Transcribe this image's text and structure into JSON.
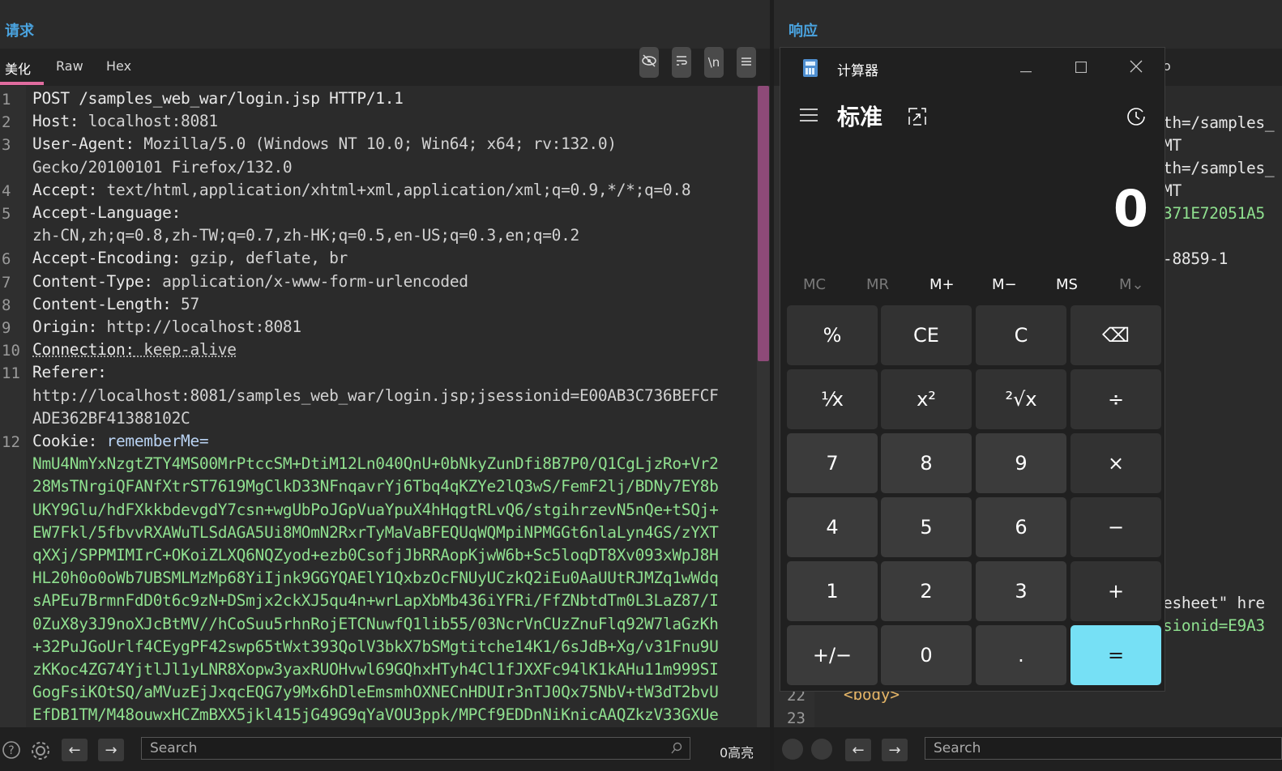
{
  "request": {
    "title": "请求",
    "tabs": [
      "美化",
      "Raw",
      "Hex"
    ],
    "toolbar": {
      "wrap": "\\n"
    },
    "lines": [
      {
        "n": "1",
        "name": "POST /samples_web_war/login.jsp HTTP/1.1",
        "value": ""
      },
      {
        "n": "2",
        "name": "Host:",
        "value": " localhost:8081"
      },
      {
        "n": "3",
        "name": "User-Agent:",
        "value": " Mozilla/5.0 (Windows NT 10.0; Win64; x64; rv:132.0)"
      },
      {
        "n": "",
        "name": "",
        "value": "Gecko/20100101 Firefox/132.0"
      },
      {
        "n": "4",
        "name": "Accept:",
        "value": " text/html,application/xhtml+xml,application/xml;q=0.9,*/*;q=0.8"
      },
      {
        "n": "5",
        "name": "Accept-Language:",
        "value": ""
      },
      {
        "n": "",
        "name": "",
        "value": "zh-CN,zh;q=0.8,zh-TW;q=0.7,zh-HK;q=0.5,en-US;q=0.3,en;q=0.2"
      },
      {
        "n": "6",
        "name": "Accept-Encoding:",
        "value": " gzip, deflate, br"
      },
      {
        "n": "7",
        "name": "Content-Type:",
        "value": " application/x-www-form-urlencoded"
      },
      {
        "n": "8",
        "name": "Content-Length:",
        "value": " 57"
      },
      {
        "n": "9",
        "name": "Origin:",
        "value": " http://localhost:8081"
      },
      {
        "n": "10",
        "name": "Connection:",
        "value": " keep-alive"
      },
      {
        "n": "11",
        "name": "Referer:",
        "value": ""
      },
      {
        "n": "",
        "name": "",
        "value": "http://localhost:8081/samples_web_war/login.jsp;jsessionid=E00AB3C736BEFCF"
      },
      {
        "n": "",
        "name": "",
        "value": "ADE362BF41388102C"
      },
      {
        "n": "12",
        "name": "Cookie:",
        "value": " rememberMe="
      }
    ],
    "cookie_lines": [
      "NmU4NmYxNzgtZTY4MS00MrPtccSM+DtiM12Ln040QnU+0bNkyZunDfi8B7P0/Q1CgLjzRo+Vr2",
      "28MsTNrgiQFANfXtrST7619MgClkD33NFnqavrYj6Tbq4qKZYe2lQ3wS/FemF2lj/BDNy7EY8b",
      "UKY9Glu/hdFXkkbdevgdY7csn+wgUbPoJGpVuaYpuX4hHqgtRLvQ6/stgihrzevN5nQe+tSQj+",
      "EW7Fkl/5fbvvRXAWuTLSdAGA5Ui8MOmN2RxrTyMaVaBFEQUqWQMpiNPMGGt6nlaLyn4GS/zYXT",
      "qXXj/SPPMIMIrC+OKoiZLXQ6NQZyod+ezb0CsofjJbRRAopKjwW6b+Sc5loqDT8Xv093xWpJ8H",
      "HL20h0o0oWb7UBSMLMzMp68YiIjnk9GGYQAElY1QxbzOcFNUyUCzkQ2iEu0AaUUtRJMZq1wWdq",
      "sAPEu7BrmnFdD0t6c9zN+DSmjx2ckXJ5qu4n+wrLapXbMb436iYFRi/FfZNbtdTm0L3LaZ87/I",
      "0ZuX8y3J9noXJcBtMV//hCoSuu5rhnRojETCNuwfQ1lib55/03NcrVnCUzZnuFlq92W7laGzKh",
      "+32PuJGoUrlf4CEygPF42swp65tWxt393QolV3bkX7bSMgtitche14K1/6sJdB+Xg/v31Fnu9U",
      "zKKoc4ZG74YjtlJl1yLNR8Xopw3yaxRUOHvwl69GQhxHTyh4Cl1fJXXFc94lK1kAHu11m999SI",
      "GogFsiKOtSQ/aMVuzEjJxqcEQG7y9Mx6hDleEmsmhOXNECnHDUIr3nTJ0Qx75NbV+tW3dT2bvU",
      "EfDB1TM/M48ouwxHCZmBXX5jkl415jG49G9qYaVOU3ppk/MPCf9EDDnNiKnicAAQZkzV33GXUe"
    ],
    "search_placeholder": "Search",
    "highlight_count": "0高亮"
  },
  "response": {
    "title": "响应",
    "tab_fragment": "o",
    "visible_fragments": [
      "th=/samples_",
      "MT",
      "th=/samples_",
      "MT",
      "371E72051A5",
      "-8859-1",
      "esheet\" hre",
      "sionid=E9A3"
    ],
    "line_numbers": [
      "22",
      "23"
    ],
    "body_tag": "<body>",
    "search_placeholder": "Search"
  },
  "calculator": {
    "window_title": "计算器",
    "mode": "标准",
    "display": "0",
    "memory": [
      "MC",
      "MR",
      "M+",
      "M−",
      "MS",
      "M⌄"
    ],
    "keys": [
      [
        "%",
        "CE",
        "C",
        "⌫"
      ],
      [
        "⅟x",
        "x²",
        "²√x",
        "÷"
      ],
      [
        "7",
        "8",
        "9",
        "×"
      ],
      [
        "4",
        "5",
        "6",
        "−"
      ],
      [
        "1",
        "2",
        "3",
        "+"
      ],
      [
        "+/−",
        "0",
        ".",
        "="
      ]
    ]
  },
  "colors": {
    "accent_blue": "#4aa3df",
    "tab_underline": "#e06c9f",
    "cookie_green": "#8fe08f",
    "equals_button": "#76e0f5"
  }
}
